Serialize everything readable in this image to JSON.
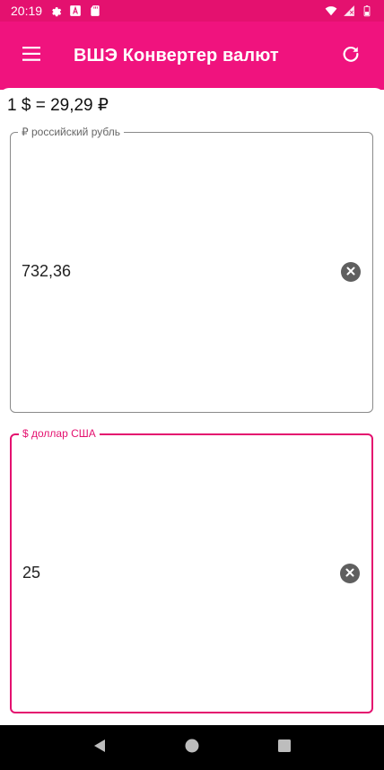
{
  "status_bar": {
    "time": "20:19",
    "icons": [
      "settings-gear-icon",
      "translate-a-icon",
      "sd-card-icon",
      "wifi-icon",
      "no-signal-icon",
      "battery-icon"
    ]
  },
  "app_bar": {
    "title": "ВШЭ Конвертер валют",
    "menu_icon": "hamburger-menu-icon",
    "refresh_icon": "refresh-icon"
  },
  "rate": {
    "text": "1 $ = 29,29 ₽"
  },
  "fields": [
    {
      "label": "₽ российский рубль",
      "value": "732,36",
      "active": false
    },
    {
      "label": "$ доллар США",
      "value": "25",
      "active": true
    }
  ],
  "colors": {
    "status_bar": "#e4116f",
    "app_bar": "#f0137e",
    "accent": "#e4116f",
    "nav_bar": "#000000"
  },
  "nav": {
    "icons": [
      "back-triangle-icon",
      "home-circle-icon",
      "recents-square-icon"
    ]
  }
}
